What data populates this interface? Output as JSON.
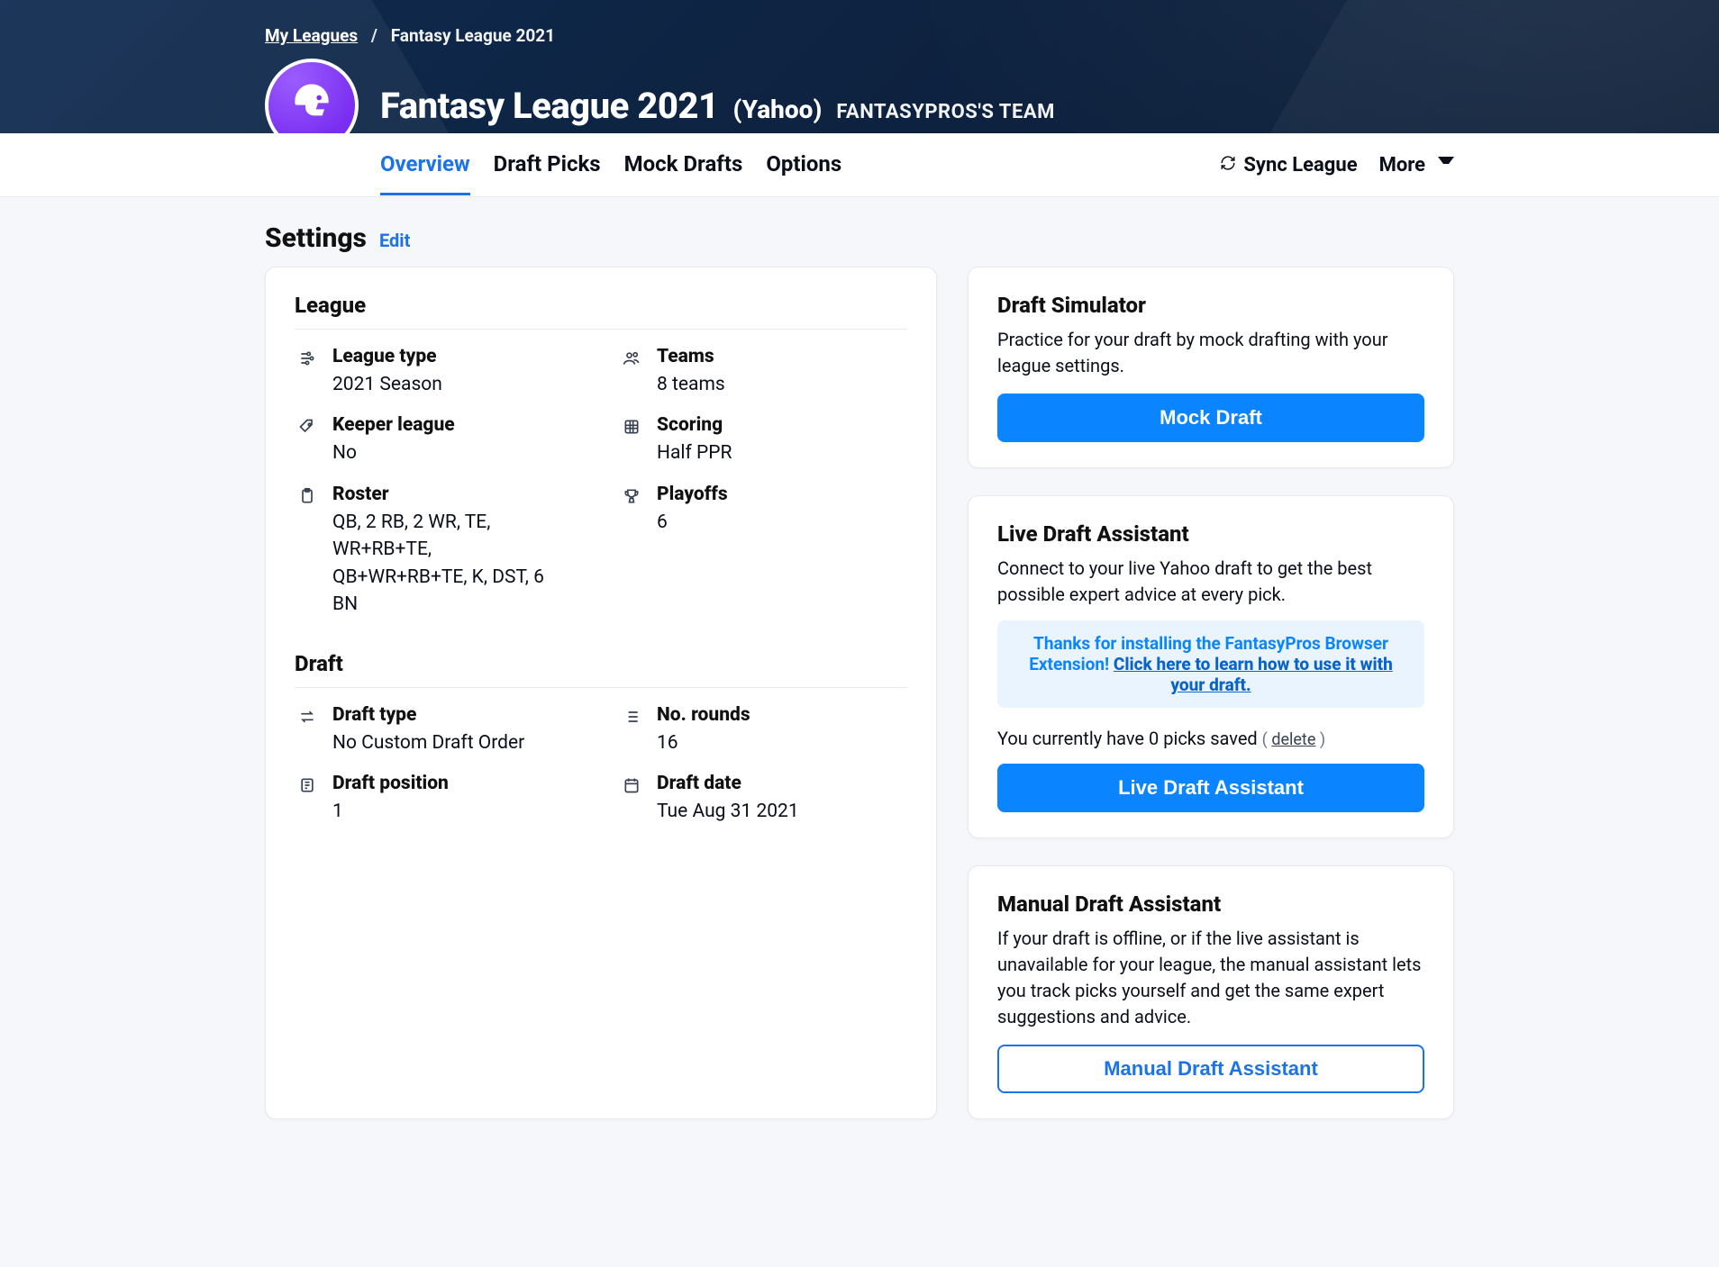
{
  "breadcrumbs": {
    "root": "My Leagues",
    "current": "Fantasy League 2021"
  },
  "header": {
    "title": "Fantasy League 2021",
    "provider": "(Yahoo)",
    "team": "FANTASYPROS'S TEAM",
    "tabs": [
      "Overview",
      "Draft Picks",
      "Mock Drafts",
      "Options"
    ],
    "sync": "Sync League",
    "more": "More"
  },
  "section": {
    "title": "Settings",
    "edit": "Edit"
  },
  "settings": {
    "league": {
      "title": "League",
      "items": [
        {
          "label": "League type",
          "value": "2021 Season",
          "icon": "sliders"
        },
        {
          "label": "Teams",
          "value": "8 teams",
          "icon": "users"
        },
        {
          "label": "Keeper league",
          "value": "No",
          "icon": "tag"
        },
        {
          "label": "Scoring",
          "value": "Half PPR",
          "icon": "grid"
        },
        {
          "label": "Roster",
          "value": "QB, 2 RB, 2 WR, TE, WR+RB+TE, QB+WR+RB+TE, K, DST, 6 BN",
          "icon": "clipboard"
        },
        {
          "label": "Playoffs",
          "value": "6",
          "icon": "trophy"
        }
      ]
    },
    "draft": {
      "title": "Draft",
      "items": [
        {
          "label": "Draft type",
          "value": "No Custom Draft Order",
          "icon": "swap"
        },
        {
          "label": "No. rounds",
          "value": "16",
          "icon": "list"
        },
        {
          "label": "Draft position",
          "value": "1",
          "icon": "position"
        },
        {
          "label": "Draft date",
          "value": "Tue Aug 31 2021",
          "icon": "calendar"
        }
      ]
    }
  },
  "cards": {
    "simulator": {
      "title": "Draft Simulator",
      "desc": "Practice for your draft by mock drafting with your league settings.",
      "cta": "Mock Draft"
    },
    "live": {
      "title": "Live Draft Assistant",
      "desc": "Connect to your live Yahoo draft to get the best possible expert advice at every pick.",
      "callout_prefix": "Thanks for installing the FantasyPros Browser Extension! ",
      "callout_link": "Click here to learn how to use it with your draft.",
      "picks_prefix": "You currently have ",
      "picks_count": "0",
      "picks_suffix": " picks saved ",
      "delete": "delete",
      "cta": "Live Draft Assistant"
    },
    "manual": {
      "title": "Manual Draft Assistant",
      "desc": "If your draft is offline, or if the live assistant is unavailable for your league, the manual assistant lets you track picks yourself and get the same expert suggestions and advice.",
      "cta": "Manual Draft Assistant"
    }
  }
}
